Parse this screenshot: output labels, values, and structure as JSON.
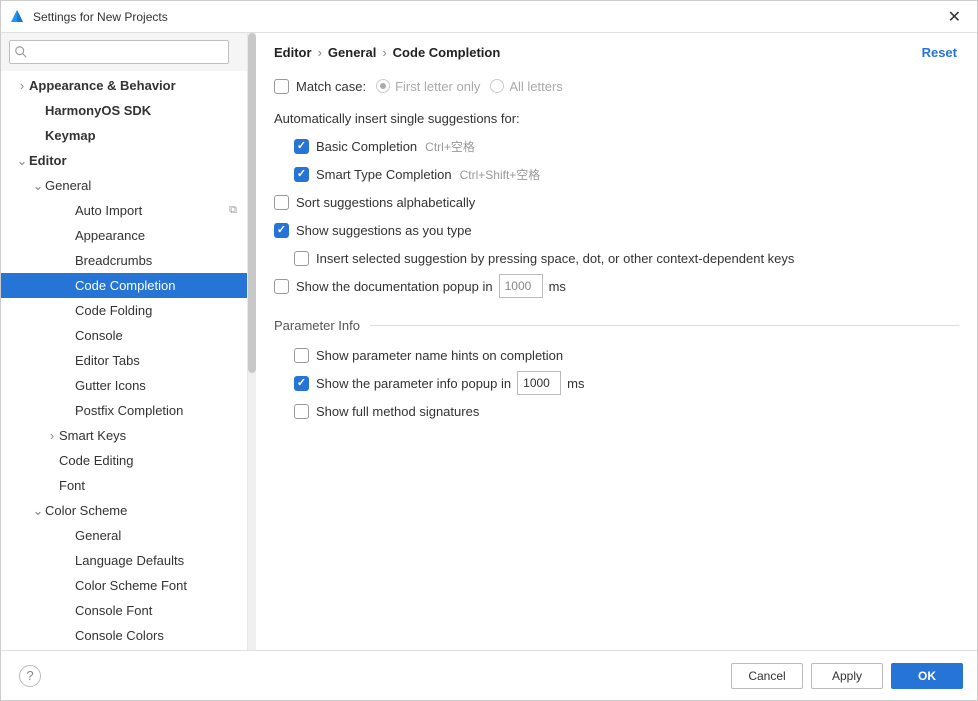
{
  "window": {
    "title": "Settings for New Projects"
  },
  "search": {
    "placeholder": ""
  },
  "tree": {
    "items": [
      {
        "label": "Appearance & Behavior",
        "bold": true,
        "indent": 1,
        "arrow": "right"
      },
      {
        "label": "HarmonyOS SDK",
        "bold": true,
        "indent": 2,
        "arrow": "none"
      },
      {
        "label": "Keymap",
        "bold": true,
        "indent": 2,
        "arrow": "none"
      },
      {
        "label": "Editor",
        "bold": true,
        "indent": 1,
        "arrow": "down"
      },
      {
        "label": "General",
        "bold": false,
        "indent": 2,
        "arrow": "down"
      },
      {
        "label": "Auto Import",
        "bold": false,
        "indent": 4,
        "arrow": "none",
        "tag": "⧉"
      },
      {
        "label": "Appearance",
        "bold": false,
        "indent": 4,
        "arrow": "none"
      },
      {
        "label": "Breadcrumbs",
        "bold": false,
        "indent": 4,
        "arrow": "none"
      },
      {
        "label": "Code Completion",
        "bold": false,
        "indent": 4,
        "arrow": "none",
        "selected": true
      },
      {
        "label": "Code Folding",
        "bold": false,
        "indent": 4,
        "arrow": "none"
      },
      {
        "label": "Console",
        "bold": false,
        "indent": 4,
        "arrow": "none"
      },
      {
        "label": "Editor Tabs",
        "bold": false,
        "indent": 4,
        "arrow": "none"
      },
      {
        "label": "Gutter Icons",
        "bold": false,
        "indent": 4,
        "arrow": "none"
      },
      {
        "label": "Postfix Completion",
        "bold": false,
        "indent": 4,
        "arrow": "none"
      },
      {
        "label": "Smart Keys",
        "bold": false,
        "indent": 3,
        "arrow": "right"
      },
      {
        "label": "Code Editing",
        "bold": false,
        "indent": 3,
        "arrow": "none"
      },
      {
        "label": "Font",
        "bold": false,
        "indent": 3,
        "arrow": "none"
      },
      {
        "label": "Color Scheme",
        "bold": false,
        "indent": 2,
        "arrow": "down"
      },
      {
        "label": "General",
        "bold": false,
        "indent": 4,
        "arrow": "none"
      },
      {
        "label": "Language Defaults",
        "bold": false,
        "indent": 4,
        "arrow": "none"
      },
      {
        "label": "Color Scheme Font",
        "bold": false,
        "indent": 4,
        "arrow": "none"
      },
      {
        "label": "Console Font",
        "bold": false,
        "indent": 4,
        "arrow": "none"
      },
      {
        "label": "Console Colors",
        "bold": false,
        "indent": 4,
        "arrow": "none"
      }
    ]
  },
  "breadcrumb": {
    "p0": "Editor",
    "p1": "General",
    "p2": "Code Completion",
    "sep": "›"
  },
  "reset_label": "Reset",
  "form": {
    "match_case": {
      "label": "Match case:",
      "checked": false
    },
    "first_letter": "First letter only",
    "all_letters": "All letters",
    "auto_insert_heading": "Automatically insert single suggestions for:",
    "basic": {
      "label": "Basic Completion",
      "hint": "Ctrl+空格",
      "checked": true
    },
    "smart": {
      "label": "Smart Type Completion",
      "hint": "Ctrl+Shift+空格",
      "checked": true
    },
    "sort_alpha": {
      "label": "Sort suggestions alphabetically",
      "checked": false
    },
    "show_as_type": {
      "label": "Show suggestions as you type",
      "checked": true
    },
    "insert_selected": {
      "label": "Insert selected suggestion by pressing space, dot, or other context-dependent keys",
      "checked": false
    },
    "show_doc": {
      "label_pre": "Show the documentation popup in",
      "value": "1000",
      "label_post": "ms",
      "checked": false
    },
    "param_heading": "Parameter Info",
    "show_param_hints": {
      "label": "Show parameter name hints on completion",
      "checked": false
    },
    "show_param_popup": {
      "label_pre": "Show the parameter info popup in",
      "value": "1000",
      "label_post": "ms",
      "checked": true
    },
    "show_full_sig": {
      "label": "Show full method signatures",
      "checked": false
    }
  },
  "footer": {
    "cancel": "Cancel",
    "apply": "Apply",
    "ok": "OK"
  }
}
